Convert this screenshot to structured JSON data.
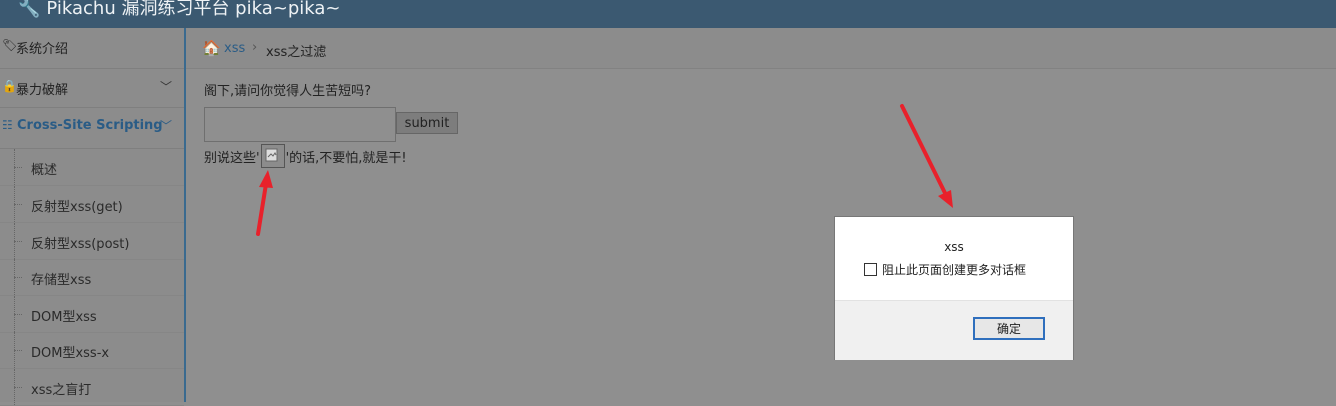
{
  "header": {
    "brand": "Pikachu 漏洞练习平台 pika~pika~",
    "icon": "wrench-icon"
  },
  "sidebar": {
    "items": [
      {
        "label": "系统介绍",
        "icon": "tags-icon"
      },
      {
        "label": "暴力破解",
        "icon": "lock-icon"
      },
      {
        "label": "Cross-Site Scripting",
        "icon": "list-icon"
      }
    ],
    "subitems": [
      "概述",
      "反射型xss(get)",
      "反射型xss(post)",
      "存储型xss",
      "DOM型xss",
      "DOM型xss-x",
      "xss之盲打"
    ]
  },
  "breadcrumb": {
    "home_icon": "home-icon",
    "parent": "xss",
    "current": "xss之过滤"
  },
  "form": {
    "question": "阁下,请问你觉得人生苦短吗?",
    "input_value": "",
    "submit_label": "submit",
    "result_prefix": "别说这些'",
    "result_suffix": "'的话,不要怕,就是干!"
  },
  "dialog": {
    "title": "xss",
    "checkbox_label": "阻止此页面创建更多对话框",
    "ok_label": "确定"
  },
  "colors": {
    "header_bg": "#3b5971",
    "accent": "#2a5c86",
    "arrow": "#e8212b"
  }
}
